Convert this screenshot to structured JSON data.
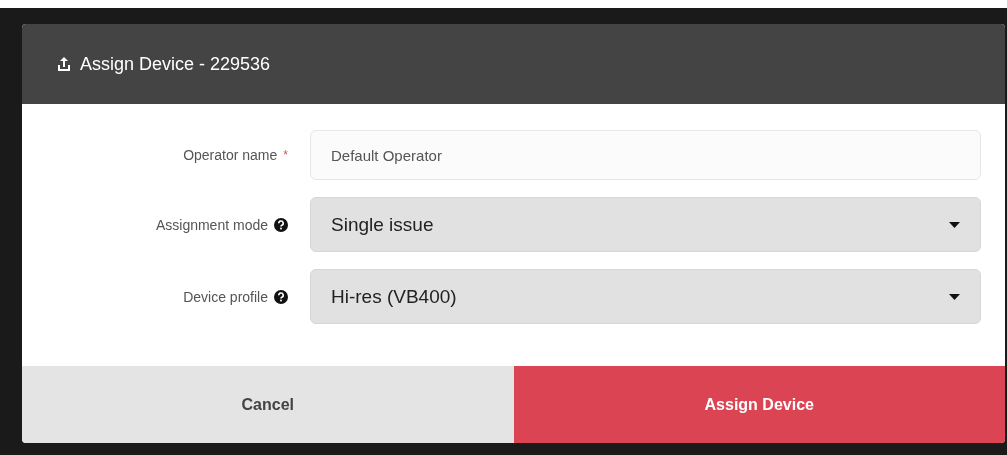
{
  "dialog": {
    "title": "Assign Device - 229536"
  },
  "fields": [
    {
      "kind": "text",
      "label": "Operator name",
      "required_mark": "*",
      "help": false,
      "value": "Default Operator"
    },
    {
      "kind": "select",
      "label": "Assignment mode",
      "help": true,
      "value": "Single issue"
    },
    {
      "kind": "select",
      "label": "Device profile",
      "help": true,
      "value": "Hi-res (VB400)"
    }
  ],
  "buttons": [
    {
      "kind": "secondary",
      "label": "Cancel"
    },
    {
      "kind": "primary",
      "label": "Assign Device"
    }
  ]
}
